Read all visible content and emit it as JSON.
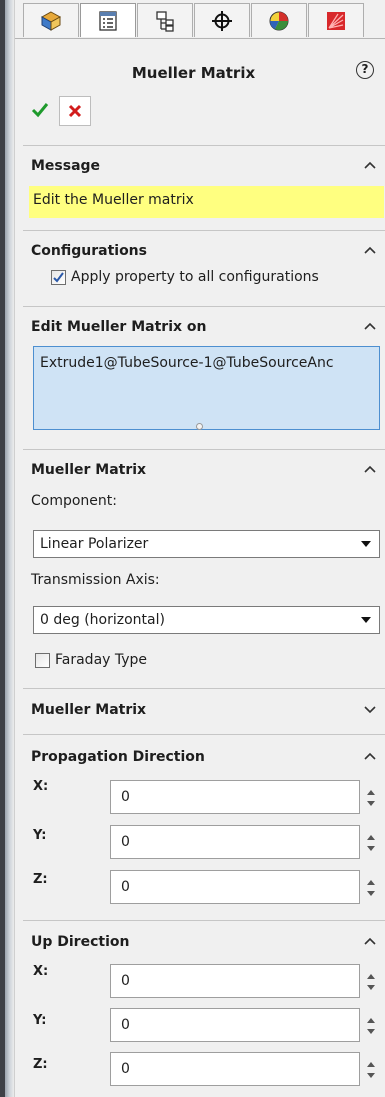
{
  "header": {
    "title": "Mueller Matrix",
    "help_label": "?"
  },
  "tabs": [
    {
      "icon": "feature-manager-icon"
    },
    {
      "icon": "property-manager-icon"
    },
    {
      "icon": "configuration-manager-icon"
    },
    {
      "icon": "dimxpert-icon"
    },
    {
      "icon": "display-manager-icon"
    },
    {
      "icon": "optical-tool-icon"
    }
  ],
  "actions": {
    "ok_icon": "checkmark-icon",
    "cancel_icon": "close-icon"
  },
  "message": {
    "title": "Message",
    "text": "Edit the Mueller matrix",
    "highlight_color": "#ffff80"
  },
  "configurations": {
    "title": "Configurations",
    "apply_label": "Apply property to all configurations",
    "apply_checked": true
  },
  "edit_on": {
    "title": "Edit Mueller Matrix on",
    "selection": "Extrude1@TubeSource-1@TubeSourceAnc"
  },
  "mueller_matrix": {
    "title": "Mueller Matrix",
    "component_label": "Component:",
    "component_value": "Linear Polarizer",
    "transmission_label": "Transmission Axis:",
    "transmission_value": "0 deg (horizontal)",
    "faraday_label": "Faraday Type",
    "faraday_checked": false
  },
  "mueller_matrix_collapsed": {
    "title": "Mueller Matrix"
  },
  "propagation": {
    "title": "Propagation Direction",
    "fields": [
      {
        "label": "X:",
        "value": "0"
      },
      {
        "label": "Y:",
        "value": "0"
      },
      {
        "label": "Z:",
        "value": "0"
      }
    ]
  },
  "up": {
    "title": "Up Direction",
    "fields": [
      {
        "label": "X:",
        "value": "0"
      },
      {
        "label": "Y:",
        "value": "0"
      },
      {
        "label": "Z:",
        "value": "0"
      }
    ]
  },
  "colors": {
    "selection_bg": "#cfe3f5",
    "selection_border": "#4d8fd0",
    "ok_green": "#1e9a2c",
    "cancel_red": "#d21c1c"
  }
}
